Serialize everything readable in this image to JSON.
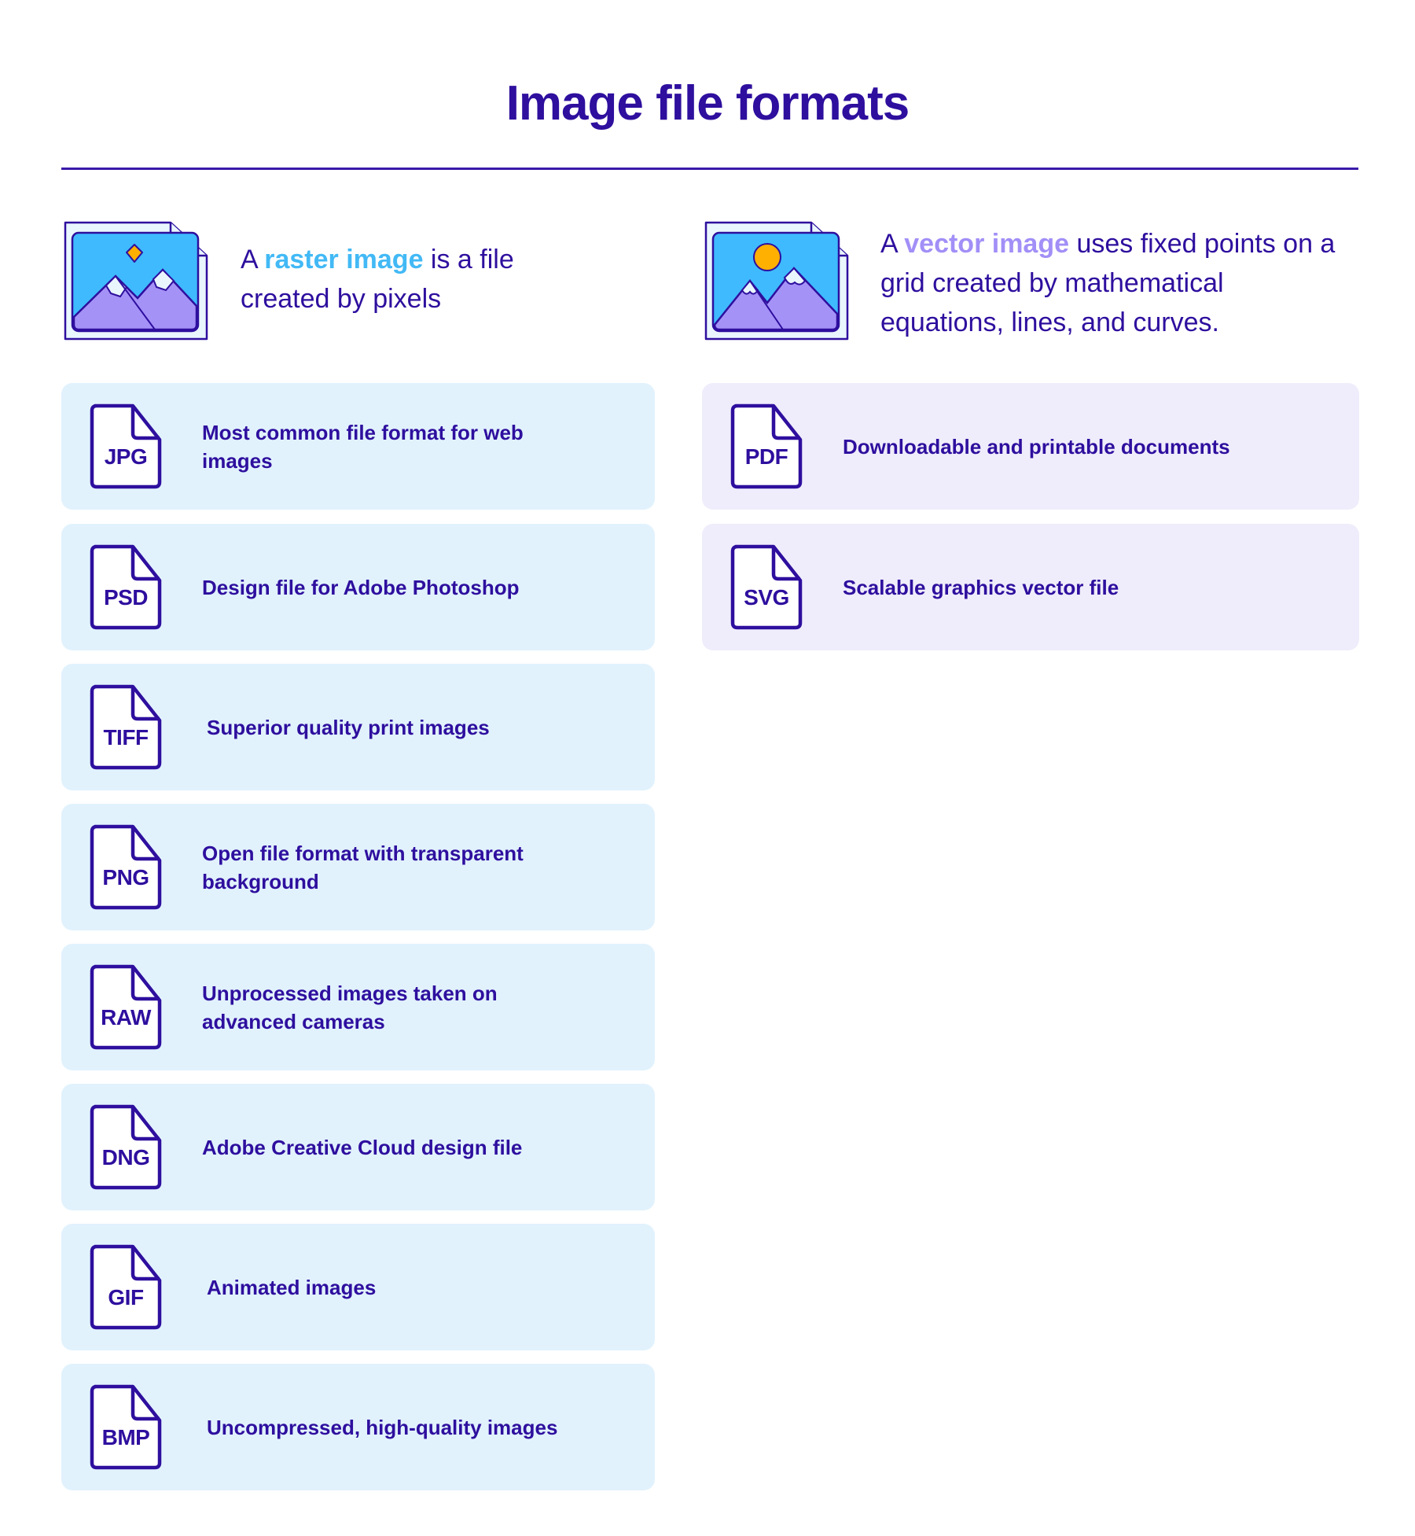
{
  "title": "Image file formats",
  "raster": {
    "intro_prefix": "A ",
    "intro_highlight": "raster image",
    "intro_suffix": " is a file created by pixels",
    "highlight_color": "#42b9f5",
    "icon": "raster-image-icon",
    "card_color": "#e1f2fd",
    "formats": [
      {
        "ext": "JPG",
        "description": "Most common file format for web images"
      },
      {
        "ext": "PSD",
        "description": "Design file for Adobe Photoshop"
      },
      {
        "ext": "TIFF",
        "description": "Superior quality print images"
      },
      {
        "ext": "PNG",
        "description": "Open file format with transparent background"
      },
      {
        "ext": "RAW",
        "description": "Unprocessed images taken on advanced cameras"
      },
      {
        "ext": "DNG",
        "description": "Adobe Creative Cloud design file"
      },
      {
        "ext": "GIF",
        "description": "Animated images"
      },
      {
        "ext": "BMP",
        "description": "Uncompressed, high-quality images"
      }
    ]
  },
  "vector": {
    "intro_prefix": "A ",
    "intro_highlight": "vector image",
    "intro_suffix": " uses fixed points on a grid created by mathematical equations, lines, and curves.",
    "highlight_color": "#a28ff7",
    "icon": "vector-image-icon",
    "card_color": "#efedfb",
    "formats": [
      {
        "ext": "PDF",
        "description": "Downloadable and printable documents"
      },
      {
        "ext": "SVG",
        "description": "Scalable graphics vector file"
      }
    ]
  },
  "colors": {
    "text": "#2e0f9e",
    "sky": "#3fbaff",
    "mountain": "#a592f7",
    "sun": "#ffb000"
  }
}
